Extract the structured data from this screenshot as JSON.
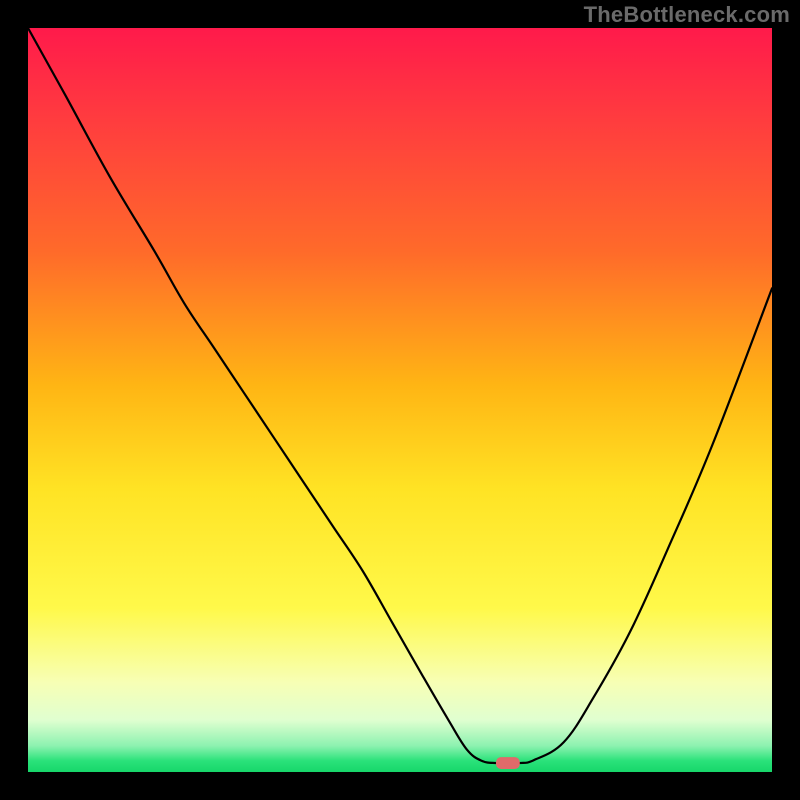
{
  "watermark": "TheBottleneck.com",
  "colors": {
    "frame": "#000000",
    "watermark": "#6a6a6a",
    "curve": "#000000",
    "marker": "#e06a6a",
    "gradient_stops": [
      {
        "offset": 0.0,
        "color": "#ff1a4b"
      },
      {
        "offset": 0.12,
        "color": "#ff3b3f"
      },
      {
        "offset": 0.3,
        "color": "#ff6a2a"
      },
      {
        "offset": 0.48,
        "color": "#ffb514"
      },
      {
        "offset": 0.62,
        "color": "#ffe324"
      },
      {
        "offset": 0.78,
        "color": "#fff94a"
      },
      {
        "offset": 0.88,
        "color": "#f7ffb5"
      },
      {
        "offset": 0.93,
        "color": "#e0ffd0"
      },
      {
        "offset": 0.965,
        "color": "#8cf2b0"
      },
      {
        "offset": 0.985,
        "color": "#2ae27a"
      },
      {
        "offset": 1.0,
        "color": "#17d66a"
      }
    ]
  },
  "chart_data": {
    "type": "line",
    "title": "",
    "xlabel": "",
    "ylabel": "",
    "xlim": [
      0,
      100
    ],
    "ylim": [
      0,
      100
    ],
    "grid": false,
    "legend": false,
    "background": "vertical-gradient",
    "series": [
      {
        "name": "bottleneck-curve",
        "x": [
          0,
          5,
          11,
          17,
          21,
          25,
          29,
          33,
          37,
          41,
          45,
          49,
          53,
          56.5,
          59,
          61,
          63,
          66,
          68,
          72,
          76,
          81,
          86,
          92,
          100
        ],
        "y": [
          100,
          91,
          80,
          70,
          63,
          57,
          51,
          45,
          39,
          33,
          27,
          20,
          13,
          7,
          3,
          1.5,
          1.2,
          1.2,
          1.6,
          4,
          10,
          19,
          30,
          44,
          65
        ]
      }
    ],
    "marker": {
      "x": 64.5,
      "y": 1.2,
      "shape": "rounded-rect",
      "w_pct": 3.2,
      "h_pct": 1.6
    },
    "annotations": []
  }
}
